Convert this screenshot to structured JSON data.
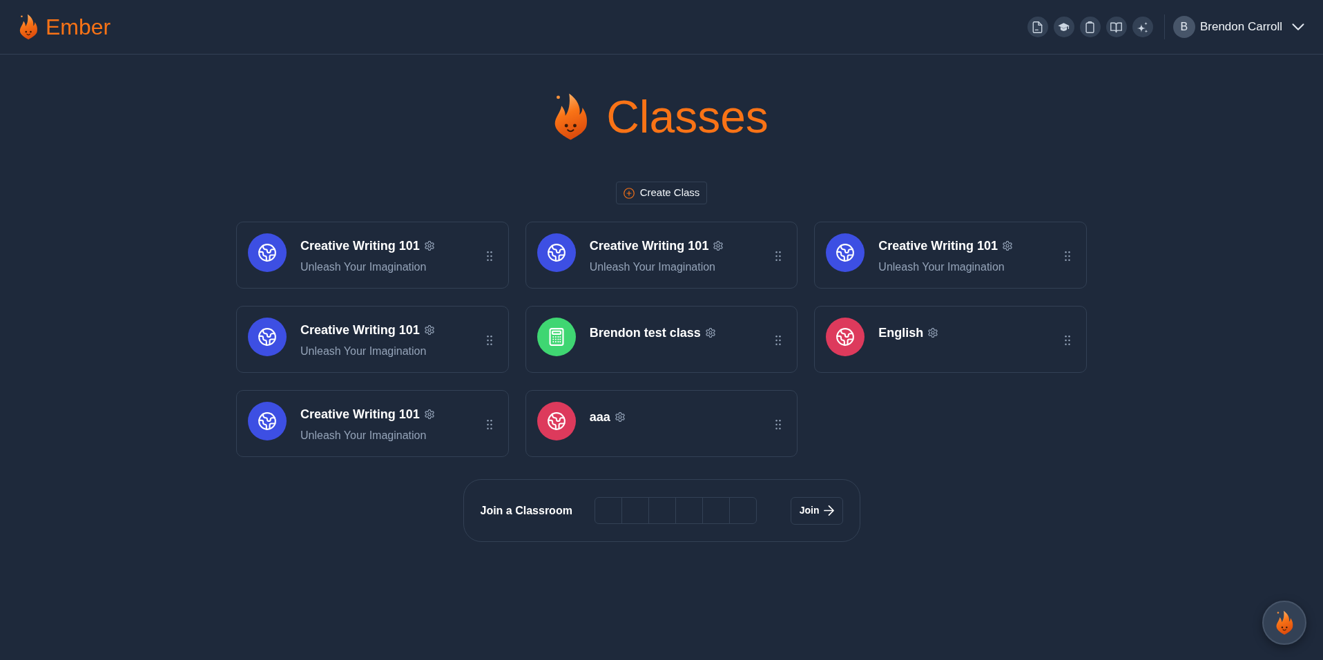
{
  "header": {
    "brand": "Ember",
    "user": {
      "initial": "B",
      "name": "Brendon Carroll"
    }
  },
  "page": {
    "title": "Classes",
    "create_button": "Create Class"
  },
  "classes": [
    {
      "title": "Creative Writing 101",
      "subtitle": "Unleash Your Imagination",
      "kind": "globe",
      "color": "#3d4fe3"
    },
    {
      "title": "Creative Writing 101",
      "subtitle": "Unleash Your Imagination",
      "kind": "globe",
      "color": "#3d4fe3"
    },
    {
      "title": "Creative Writing 101",
      "subtitle": "Unleash Your Imagination",
      "kind": "globe",
      "color": "#3d4fe3"
    },
    {
      "title": "Creative Writing 101",
      "subtitle": "Unleash Your Imagination",
      "kind": "globe",
      "color": "#3d4fe3"
    },
    {
      "title": "Brendon test class",
      "kind": "calculator",
      "color": "#3fd672"
    },
    {
      "title": "English",
      "kind": "globe",
      "color": "#dd3a5c"
    },
    {
      "title": "Creative Writing 101",
      "subtitle": "Unleash Your Imagination",
      "kind": "globe",
      "color": "#3d4fe3"
    },
    {
      "title": "aaa",
      "kind": "globe",
      "color": "#dd3a5c"
    }
  ],
  "join": {
    "label": "Join a Classroom",
    "button": "Join"
  }
}
